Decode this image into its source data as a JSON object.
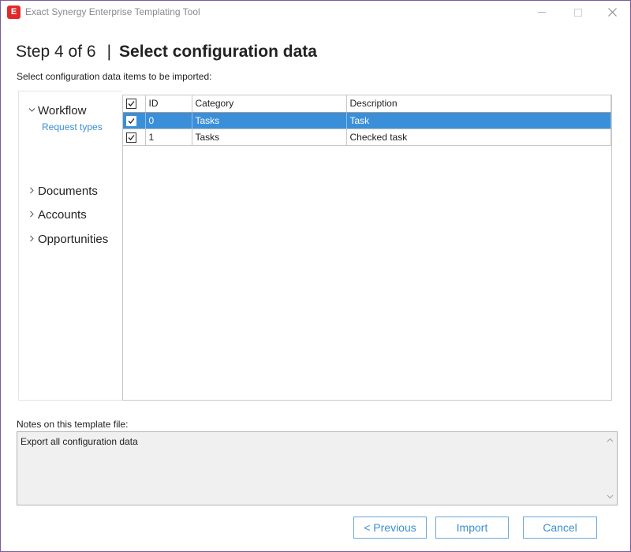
{
  "window": {
    "title": "Exact Synergy Enterprise Templating Tool",
    "icon_letter": "E",
    "accent_color": "#e02a2a"
  },
  "heading": {
    "step": "Step 4 of 6",
    "separator": "|",
    "title": "Select configuration data"
  },
  "instruction": "Select configuration data items to be imported:",
  "nav": {
    "items": [
      {
        "label": "Workflow",
        "expanded": true,
        "subitems": [
          "Request types"
        ]
      },
      {
        "label": "Documents",
        "expanded": false
      },
      {
        "label": "Accounts",
        "expanded": false
      },
      {
        "label": "Opportunities",
        "expanded": false
      }
    ]
  },
  "grid": {
    "columns": [
      "ID",
      "Category",
      "Description"
    ],
    "header_checked": true,
    "rows": [
      {
        "checked": true,
        "id": "0",
        "category": "Tasks",
        "description": "Task",
        "selected": true
      },
      {
        "checked": true,
        "id": "1",
        "category": "Tasks",
        "description": "Checked task",
        "selected": false
      }
    ],
    "selection_color": "#3b8fd8"
  },
  "notes": {
    "label": "Notes on this template file:",
    "value": "Export all configuration data"
  },
  "buttons": {
    "previous": "< Previous",
    "import": "Import",
    "cancel": "Cancel"
  }
}
